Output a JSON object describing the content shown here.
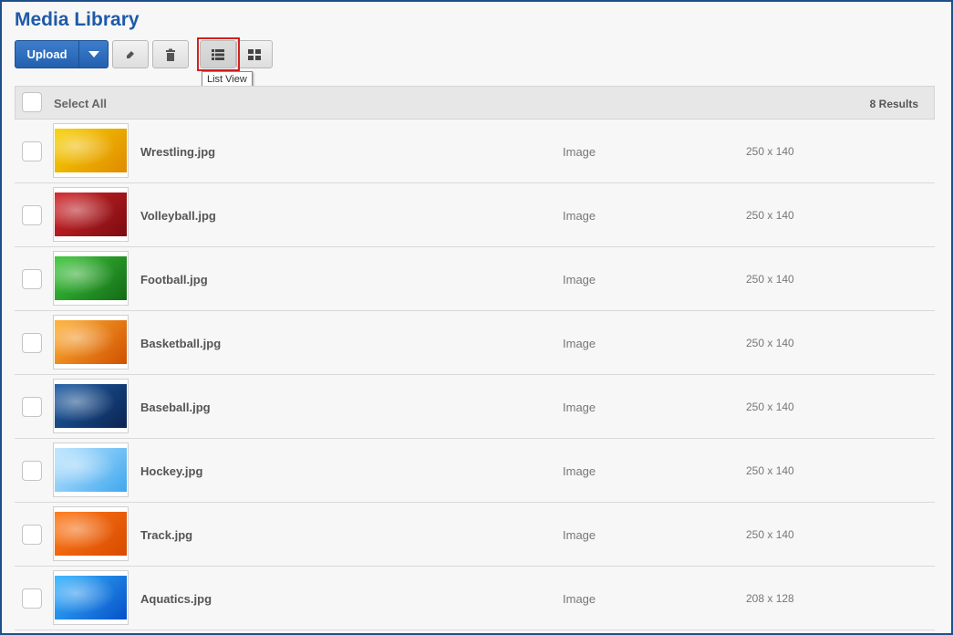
{
  "header": {
    "title": "Media Library"
  },
  "toolbar": {
    "upload_label": "Upload",
    "tooltip": "List View",
    "icons": {
      "upload_menu": "caret-down-icon",
      "edit": "pencil-icon",
      "delete": "trash-icon",
      "list_view": "list-view-icon",
      "grid_view": "grid-view-icon"
    }
  },
  "list": {
    "select_all_label": "Select All",
    "results_label": "8 Results",
    "items": [
      {
        "name": "Wrestling.jpg",
        "type": "Image",
        "dimensions": "250 x 140",
        "thumb_colors": [
          "#f7d200",
          "#e08a00"
        ]
      },
      {
        "name": "Volleyball.jpg",
        "type": "Image",
        "dimensions": "250 x 140",
        "thumb_colors": [
          "#d4252a",
          "#7a0c10"
        ]
      },
      {
        "name": "Football.jpg",
        "type": "Image",
        "dimensions": "250 x 140",
        "thumb_colors": [
          "#3cc83a",
          "#136b16"
        ]
      },
      {
        "name": "Basketball.jpg",
        "type": "Image",
        "dimensions": "250 x 140",
        "thumb_colors": [
          "#ffb234",
          "#d05000"
        ]
      },
      {
        "name": "Baseball.jpg",
        "type": "Image",
        "dimensions": "250 x 140",
        "thumb_colors": [
          "#1f5fa6",
          "#0b2452"
        ]
      },
      {
        "name": "Hockey.jpg",
        "type": "Image",
        "dimensions": "250 x 140",
        "thumb_colors": [
          "#bfe6ff",
          "#3fa7ee"
        ]
      },
      {
        "name": "Track.jpg",
        "type": "Image",
        "dimensions": "250 x 140",
        "thumb_colors": [
          "#ff7a18",
          "#d84a00"
        ]
      },
      {
        "name": "Aquatics.jpg",
        "type": "Image",
        "dimensions": "208 x 128",
        "thumb_colors": [
          "#38b6ff",
          "#0650c8"
        ]
      }
    ]
  },
  "colors": {
    "title": "#1e5aa8",
    "upload_button": "#2d6dbd",
    "highlight": "#d42020",
    "frame": "#1f4f8a"
  }
}
